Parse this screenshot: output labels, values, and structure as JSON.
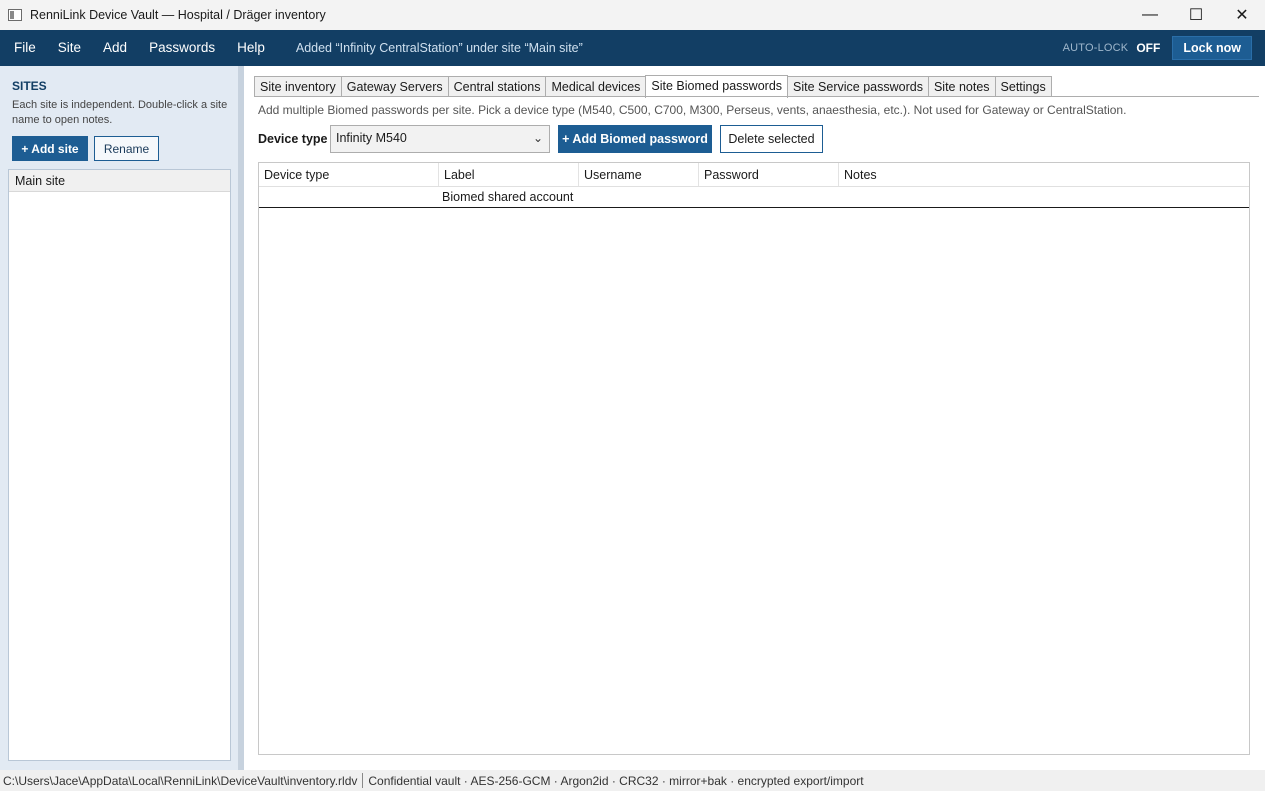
{
  "window": {
    "title": "RenniLink Device Vault — Hospital / Dräger inventory",
    "minimize": "—",
    "maximize": "☐",
    "close": "✕"
  },
  "menu": {
    "items": [
      "File",
      "Site",
      "Add",
      "Passwords",
      "Help"
    ],
    "status_message": "Added “Infinity CentralStation” under site “Main site”",
    "autolock_label": "AUTO-LOCK",
    "autolock_state": "OFF",
    "lock_now": "Lock now"
  },
  "sidebar": {
    "header": "SITES",
    "description": "Each site is independent. Double-click a site name to open notes.",
    "add_site": "+ Add site",
    "rename": "Rename",
    "sites": [
      "Main site"
    ]
  },
  "tabs": [
    {
      "label": "Site inventory",
      "active": false
    },
    {
      "label": "Gateway Servers",
      "active": false
    },
    {
      "label": "Central stations",
      "active": false
    },
    {
      "label": "Medical devices",
      "active": false
    },
    {
      "label": "Site Biomed passwords",
      "active": true
    },
    {
      "label": "Site Service passwords",
      "active": false
    },
    {
      "label": "Site notes",
      "active": false
    },
    {
      "label": "Settings",
      "active": false
    }
  ],
  "biomed": {
    "hint": "Add multiple Biomed passwords per site. Pick a device type (M540, C500, C700, M300, Perseus, vents, anaesthesia, etc.). Not used for Gateway or CentralStation.",
    "device_type_label": "Device type",
    "device_type_value": "Infinity M540",
    "add_button": "+ Add Biomed password",
    "delete_button": "Delete selected",
    "columns": [
      "Device type",
      "Label",
      "Username",
      "Password",
      "Notes"
    ],
    "rows": [
      {
        "device_type": "",
        "label": "Biomed shared account",
        "username": "",
        "password": "",
        "notes": ""
      }
    ]
  },
  "statusbar": {
    "path": "C:\\Users\\Jace\\AppData\\Local\\RenniLink\\DeviceVault\\inventory.rldv",
    "info": "Confidential vault · AES-256-GCM · Argon2id · CRC32 · mirror+bak · encrypted export/import"
  },
  "colors": {
    "accent": "#123e64",
    "button": "#1d5d93",
    "sidebar_bg": "#e2eaf3"
  }
}
